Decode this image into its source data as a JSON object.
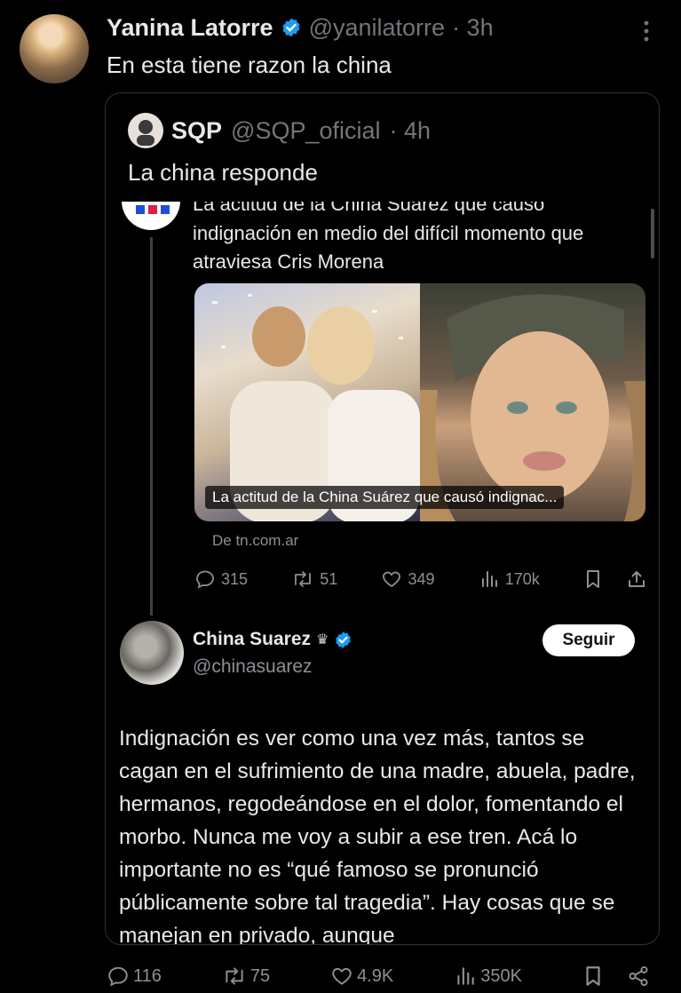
{
  "main_tweet": {
    "author_name": "Yanina Latorre",
    "handle": "@yanilatorre",
    "time": "· 3h",
    "text": "En esta tiene razon la china",
    "more_icon": "more-vertical-icon",
    "stats": {
      "replies": "116",
      "reposts": "75",
      "likes": "4.9K",
      "views": "350K"
    }
  },
  "quoted_tweet": {
    "author_name": "SQP",
    "handle": "@SQP_oficial",
    "time": "· 4h",
    "text": "La china responde"
  },
  "inner_news_tweet": {
    "headline_cut": "La actitud de la China Suárez que causó",
    "headline_rest": "indignación en medio del difícil momento que atraviesa Cris Morena",
    "card_caption": "La actitud de la China Suárez que causó indignac...",
    "source": "De tn.com.ar",
    "stats": {
      "replies": "315",
      "reposts": "51",
      "likes": "349",
      "views": "170k"
    }
  },
  "china_tweet": {
    "author_name": "China Suarez",
    "crown": "♛",
    "handle": "@chinasuarez",
    "follow_label": "Seguir",
    "body": "Indignación es ver como una vez más, tantos se cagan en el sufrimiento de una madre, abuela, padre, hermanos, regodeándose en el dolor, fomentando el morbo. Nunca me voy a subir a ese tren. Acá lo importante no es “qué famoso se pronunció públicamente sobre tal tragedia”. Hay cosas que se manejan en privado, aunque"
  },
  "colors": {
    "background": "#000000",
    "text": "#e7e9ea",
    "muted": "#71767b",
    "verified": "#1d9bf0",
    "border": "#2f3336"
  }
}
